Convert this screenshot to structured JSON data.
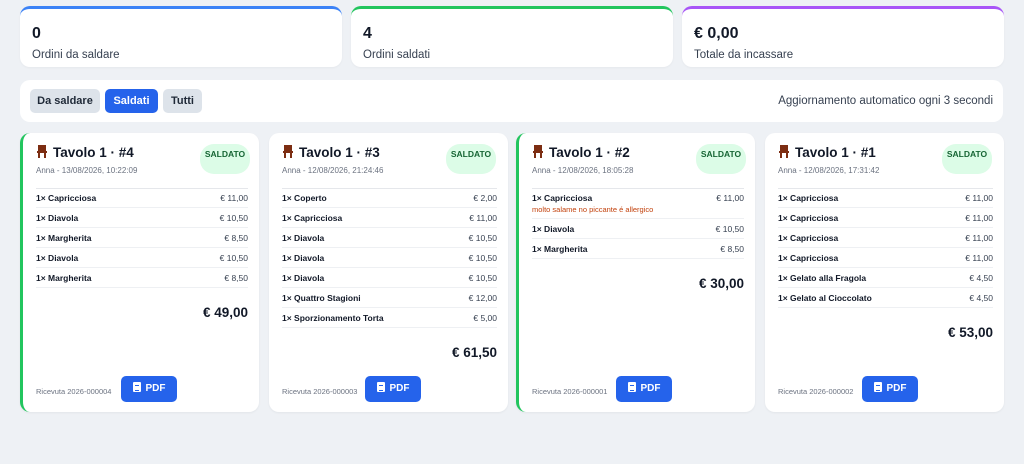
{
  "stats": [
    {
      "value": "0",
      "label": "Ordini da saldare",
      "color": "#3b82f6"
    },
    {
      "value": "4",
      "label": "Ordini saldati",
      "color": "#22c55e"
    },
    {
      "value": "€ 0,00",
      "label": "Totale da incassare",
      "color": "#a855f7"
    }
  ],
  "filters": {
    "tabs": [
      "Da saldare",
      "Saldati",
      "Tutti"
    ],
    "active": "Saldati"
  },
  "auto_refresh": "Aggiornamento automatico ogni 3 secondi",
  "colors": {
    "primary": "#2563eb",
    "paid_badge_bg": "#dcfce7",
    "paid_badge_text": "#166534",
    "note_text": "#c2410c"
  },
  "orders": [
    {
      "title": "Tavolo 1 · #4",
      "subtitle": "Anna - 13/08/2026, 10:22:09",
      "status": "SALDATO",
      "items": [
        {
          "name": "1× Capricciosa",
          "price": "€ 11,00"
        },
        {
          "name": "1× Diavola",
          "price": "€ 10,50"
        },
        {
          "name": "1× Margherita",
          "price": "€ 8,50"
        },
        {
          "name": "1× Diavola",
          "price": "€ 10,50"
        },
        {
          "name": "1× Margherita",
          "price": "€ 8,50"
        }
      ],
      "total": "€ 49,00",
      "receipt": "Ricevuta 2026-000004",
      "pdf_label": "PDF"
    },
    {
      "title": "Tavolo 1 · #3",
      "subtitle": "Anna - 12/08/2026, 21:24:46",
      "status": "SALDATO",
      "items": [
        {
          "name": "1× Coperto",
          "price": "€ 2,00"
        },
        {
          "name": "1× Capricciosa",
          "price": "€ 11,00"
        },
        {
          "name": "1× Diavola",
          "price": "€ 10,50"
        },
        {
          "name": "1× Diavola",
          "price": "€ 10,50"
        },
        {
          "name": "1× Diavola",
          "price": "€ 10,50"
        },
        {
          "name": "1× Quattro Stagioni",
          "price": "€ 12,00"
        },
        {
          "name": "1× Sporzionamento Torta",
          "price": "€ 5,00"
        }
      ],
      "total": "€ 61,50",
      "receipt": "Ricevuta 2026-000003",
      "pdf_label": "PDF"
    },
    {
      "title": "Tavolo 1 · #2",
      "subtitle": "Anna - 12/08/2026, 18:05:28",
      "status": "SALDATO",
      "items": [
        {
          "name": "1× Capricciosa",
          "price": "€ 11,00",
          "note": "molto salame no piccante é allergico"
        },
        {
          "name": "1× Diavola",
          "price": "€ 10,50"
        },
        {
          "name": "1× Margherita",
          "price": "€ 8,50"
        }
      ],
      "total": "€ 30,00",
      "receipt": "Ricevuta 2026-000001",
      "pdf_label": "PDF"
    },
    {
      "title": "Tavolo 1 · #1",
      "subtitle": "Anna - 12/08/2026, 17:31:42",
      "status": "SALDATO",
      "items": [
        {
          "name": "1× Capricciosa",
          "price": "€ 11,00"
        },
        {
          "name": "1× Capricciosa",
          "price": "€ 11,00"
        },
        {
          "name": "1× Capricciosa",
          "price": "€ 11,00"
        },
        {
          "name": "1× Capricciosa",
          "price": "€ 11,00"
        },
        {
          "name": "1× Gelato alla Fragola",
          "price": "€ 4,50"
        },
        {
          "name": "1× Gelato al Cioccolato",
          "price": "€ 4,50"
        }
      ],
      "total": "€ 53,00",
      "receipt": "Ricevuta 2026-000002",
      "pdf_label": "PDF"
    }
  ]
}
